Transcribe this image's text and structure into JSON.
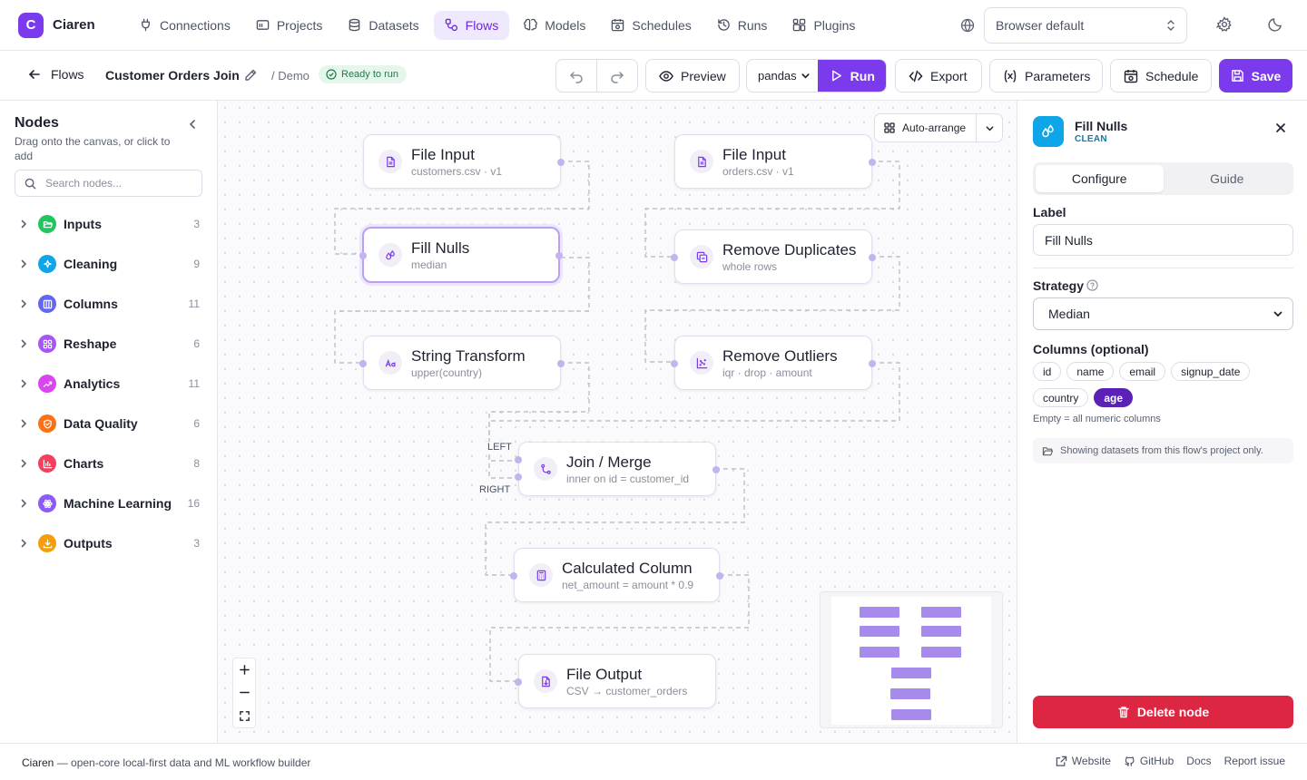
{
  "brand": {
    "logo_letter": "C",
    "name": "Ciaren",
    "accent": "#7c3aed"
  },
  "nav": {
    "items": [
      {
        "label": "Connections",
        "icon": "plug-icon"
      },
      {
        "label": "Projects",
        "icon": "folder-icon"
      },
      {
        "label": "Datasets",
        "icon": "database-icon"
      },
      {
        "label": "Flows",
        "icon": "flow-icon",
        "active": true
      },
      {
        "label": "Models",
        "icon": "brain-icon"
      },
      {
        "label": "Schedules",
        "icon": "calendar-icon"
      },
      {
        "label": "Runs",
        "icon": "history-icon"
      },
      {
        "label": "Plugins",
        "icon": "puzzle-icon"
      }
    ],
    "language": "Browser default"
  },
  "toolbar": {
    "back_label": "Flows",
    "flow_name": "Customer Orders Join",
    "project": "/ Demo",
    "status": "Ready to run",
    "preview": "Preview",
    "engine": "pandas",
    "run": "Run",
    "export": "Export",
    "parameters": "Parameters",
    "schedule": "Schedule",
    "save": "Save"
  },
  "sidebar": {
    "title": "Nodes",
    "hint": "Drag onto the canvas, or click to add",
    "search_placeholder": "Search nodes...",
    "categories": [
      {
        "label": "Inputs",
        "count": "3",
        "color": "#22c55e",
        "icon": "folder-open-icon"
      },
      {
        "label": "Cleaning",
        "count": "9",
        "color": "#0ea5e9",
        "icon": "sparkles-icon"
      },
      {
        "label": "Columns",
        "count": "11",
        "color": "#6366f1",
        "icon": "columns-icon"
      },
      {
        "label": "Reshape",
        "count": "6",
        "color": "#a855f7",
        "icon": "grid-icon"
      },
      {
        "label": "Analytics",
        "count": "11",
        "color": "#d946ef",
        "icon": "trend-icon"
      },
      {
        "label": "Data Quality",
        "count": "6",
        "color": "#f97316",
        "icon": "shield-check-icon"
      },
      {
        "label": "Charts",
        "count": "8",
        "color": "#f43f5e",
        "icon": "bar-chart-icon"
      },
      {
        "label": "Machine Learning",
        "count": "16",
        "color": "#8b5cf6",
        "icon": "atom-icon"
      },
      {
        "label": "Outputs",
        "count": "3",
        "color": "#f59e0b",
        "icon": "download-icon"
      }
    ]
  },
  "canvas": {
    "auto_arrange": "Auto-arrange",
    "nodes": {
      "file_input_1": {
        "title": "File Input",
        "sub": "customers.csv · v1"
      },
      "fill_nulls": {
        "title": "Fill Nulls",
        "sub": "median"
      },
      "string_transform": {
        "title": "String Transform",
        "sub": "upper(country)"
      },
      "file_input_2": {
        "title": "File Input",
        "sub": "orders.csv · v1"
      },
      "remove_duplicates": {
        "title": "Remove Duplicates",
        "sub": "whole rows"
      },
      "remove_outliers": {
        "title": "Remove Outliers",
        "sub": "iqr · drop · amount"
      },
      "join": {
        "title": "Join / Merge",
        "sub": "inner on id = customer_id",
        "left_label": "LEFT",
        "right_label": "RIGHT"
      },
      "calc_column": {
        "title": "Calculated Column",
        "sub": "net_amount = amount * 0.9"
      },
      "file_output": {
        "title": "File Output",
        "sub": "CSV → customer_orders"
      }
    }
  },
  "panel": {
    "node_title": "Fill Nulls",
    "node_category": "CLEAN",
    "tabs": [
      "Configure",
      "Guide"
    ],
    "label_field": "Label",
    "label_value": "Fill Nulls",
    "strategy_field": "Strategy",
    "strategy_value": "Median",
    "columns_field": "Columns (optional)",
    "columns": [
      {
        "name": "id",
        "selected": false
      },
      {
        "name": "name",
        "selected": false
      },
      {
        "name": "email",
        "selected": false
      },
      {
        "name": "signup_date",
        "selected": false
      },
      {
        "name": "country",
        "selected": false
      },
      {
        "name": "age",
        "selected": true
      }
    ],
    "columns_hint": "Empty = all numeric columns",
    "note": "Showing datasets from this flow's project only.",
    "delete": "Delete node"
  },
  "footer": {
    "brand": "Ciaren",
    "tagline": " — open-core local-first data and ML workflow builder",
    "links": [
      "Website",
      "GitHub",
      "Docs",
      "Report issue"
    ]
  }
}
